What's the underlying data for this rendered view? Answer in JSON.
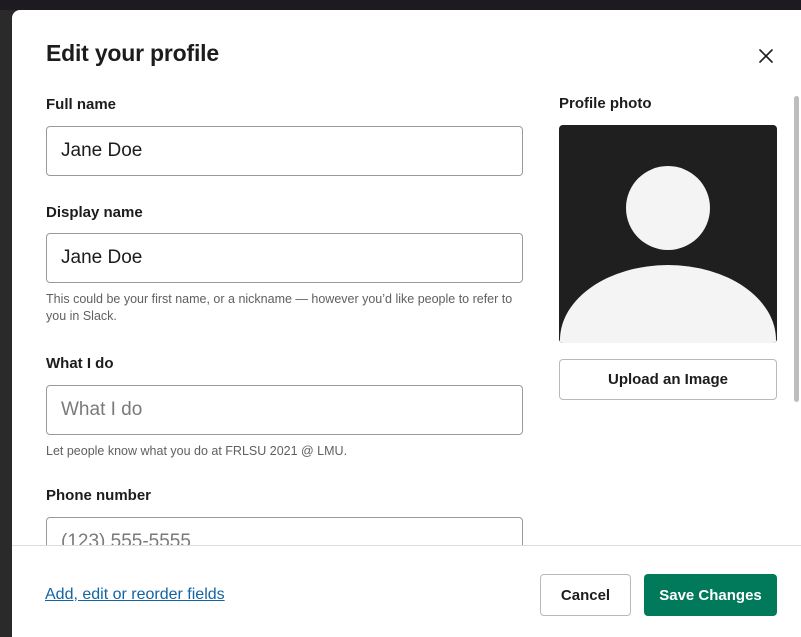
{
  "modal": {
    "title": "Edit your profile"
  },
  "fields": {
    "full_name": {
      "label": "Full name",
      "value": "Jane Doe"
    },
    "display_name": {
      "label": "Display name",
      "value": "Jane Doe",
      "hint": "This could be your first name, or a nickname — however you’d like people to refer to you in Slack."
    },
    "what_i_do": {
      "label": "What I do",
      "value": "",
      "placeholder": "What I do",
      "hint": "Let people know what you do at FRLSU 2021 @ LMU."
    },
    "phone": {
      "label": "Phone number",
      "value": "",
      "placeholder": "(123) 555-5555"
    }
  },
  "photo": {
    "label": "Profile photo",
    "upload_label": "Upload an Image",
    "icon": "default-avatar-icon"
  },
  "footer": {
    "link_label": "Add, edit or reorder fields",
    "cancel_label": "Cancel",
    "save_label": "Save Changes"
  },
  "colors": {
    "primary": "#007a5a",
    "link": "#1264a3",
    "text": "#1d1c1d",
    "hint": "#616061",
    "avatar_bg": "#1f1f1f"
  }
}
